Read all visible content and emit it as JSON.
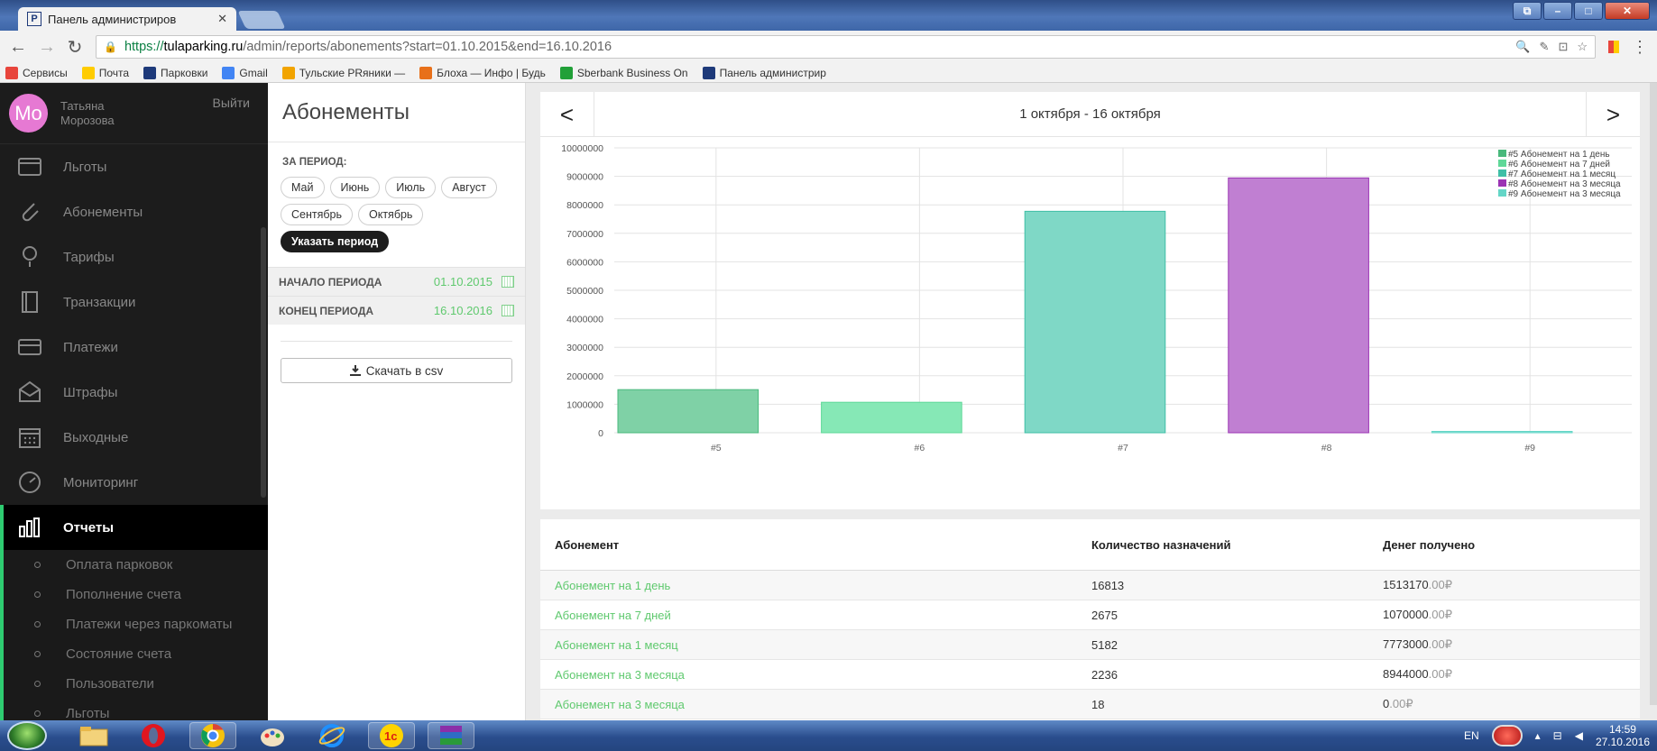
{
  "browser": {
    "tab_title": "Панель администриров",
    "tab_close": "✕",
    "url_scheme": "https://",
    "url_host": "tulaparking.ru",
    "url_path": "/admin/reports/abonements?start=01.10.2015&end=16.10.2016",
    "bookmarks": [
      {
        "label": "Сервисы",
        "icon": "apps-icon",
        "color": "#e8453c"
      },
      {
        "label": "Почта",
        "icon": "mail-icon",
        "color": "#ffcc00"
      },
      {
        "label": "Парковки",
        "icon": "p-icon",
        "color": "#1e3a7a"
      },
      {
        "label": "Gmail",
        "icon": "g-icon",
        "color": "#4285f4"
      },
      {
        "label": "Тульские PRяники —",
        "icon": "bookmark-icon",
        "color": "#f2a400"
      },
      {
        "label": "Блоха — Инфо | Будь",
        "icon": "flea-icon",
        "color": "#e8701a"
      },
      {
        "label": "Sberbank Business On",
        "icon": "sber-icon",
        "color": "#21a038"
      },
      {
        "label": "Панель администрир",
        "icon": "p-icon",
        "color": "#1e3a7a"
      }
    ]
  },
  "user": {
    "initials": "Mo",
    "first_name": "Татьяна",
    "last_name": "Морозова",
    "logout": "Выйти",
    "avatar_color": "#e679d3"
  },
  "nav": {
    "items": [
      {
        "label": "Льготы",
        "icon": "card-icon"
      },
      {
        "label": "Абонементы",
        "icon": "paperclip-icon"
      },
      {
        "label": "Тарифы",
        "icon": "pin-icon"
      },
      {
        "label": "Транзакции",
        "icon": "book-icon"
      },
      {
        "label": "Платежи",
        "icon": "credit-card-icon"
      },
      {
        "label": "Штрафы",
        "icon": "envelope-icon"
      },
      {
        "label": "Выходные",
        "icon": "calendar-icon"
      },
      {
        "label": "Мониторинг",
        "icon": "gauge-icon"
      }
    ],
    "active": {
      "label": "Отчеты",
      "icon": "bar-chart-icon"
    },
    "sub_items": [
      "Оплата парковок",
      "Пополнение счета",
      "Платежи через паркоматы",
      "Состояние счета",
      "Пользователи",
      "Льготы"
    ]
  },
  "filter": {
    "title": "Абонементы",
    "period_label": "ЗА ПЕРИОД:",
    "months": [
      "Май",
      "Июнь",
      "Июль",
      "Август",
      "Сентябрь",
      "Октябрь"
    ],
    "custom_period": "Указать период",
    "start_label": "НАЧАЛО ПЕРИОДА",
    "start_value": "01.10.2015",
    "end_label": "КОНЕЦ ПЕРИОДА",
    "end_value": "16.10.2016",
    "download": "Скачать в csv"
  },
  "chart_header": {
    "prev": "<",
    "next": ">",
    "range": "1 октября - 16 октября"
  },
  "chart_data": {
    "type": "bar",
    "categories": [
      "#5",
      "#6",
      "#7",
      "#8",
      "#9"
    ],
    "values": [
      1513170,
      1070000,
      7773000,
      8944000,
      0
    ],
    "colors": [
      "#7fd1a6",
      "#86e8b6",
      "#7fd8c6",
      "#c07fd2",
      "#8de3d8"
    ],
    "ylim": [
      0,
      10000000
    ],
    "yticks": [
      0,
      1000000,
      2000000,
      3000000,
      4000000,
      5000000,
      6000000,
      7000000,
      8000000,
      9000000,
      10000000
    ],
    "grid": true,
    "legend_position": "top-right",
    "legend": [
      {
        "label": "#5 Абонемент на 1 день",
        "color": "#49b97c"
      },
      {
        "label": "#6 Абонемент на 7 дней",
        "color": "#5fd898"
      },
      {
        "label": "#7 Абонемент на 1 месяц",
        "color": "#3fbfa6"
      },
      {
        "label": "#8 Абонемент на 3 месяца",
        "color": "#9b34b4"
      },
      {
        "label": "#9 Абонемент на 3 месяца",
        "color": "#64d6c7"
      }
    ]
  },
  "table": {
    "headers": [
      "Абонемент",
      "Количество назначений",
      "Денег получено"
    ],
    "currency": "₽",
    "rows": [
      {
        "name": "Абонемент на 1 день",
        "count": "16813",
        "amount": "1513170",
        "cents": ".00"
      },
      {
        "name": "Абонемент на 7 дней",
        "count": "2675",
        "amount": "1070000",
        "cents": ".00"
      },
      {
        "name": "Абонемент на 1 месяц",
        "count": "5182",
        "amount": "7773000",
        "cents": ".00"
      },
      {
        "name": "Абонемент на 3 месяца",
        "count": "2236",
        "amount": "8944000",
        "cents": ".00"
      },
      {
        "name": "Абонемент на 3 месяца",
        "count": "18",
        "amount": "0",
        "cents": ".00"
      }
    ]
  },
  "taskbar": {
    "lang": "EN",
    "time": "14:59",
    "date": "27.10.2016"
  }
}
